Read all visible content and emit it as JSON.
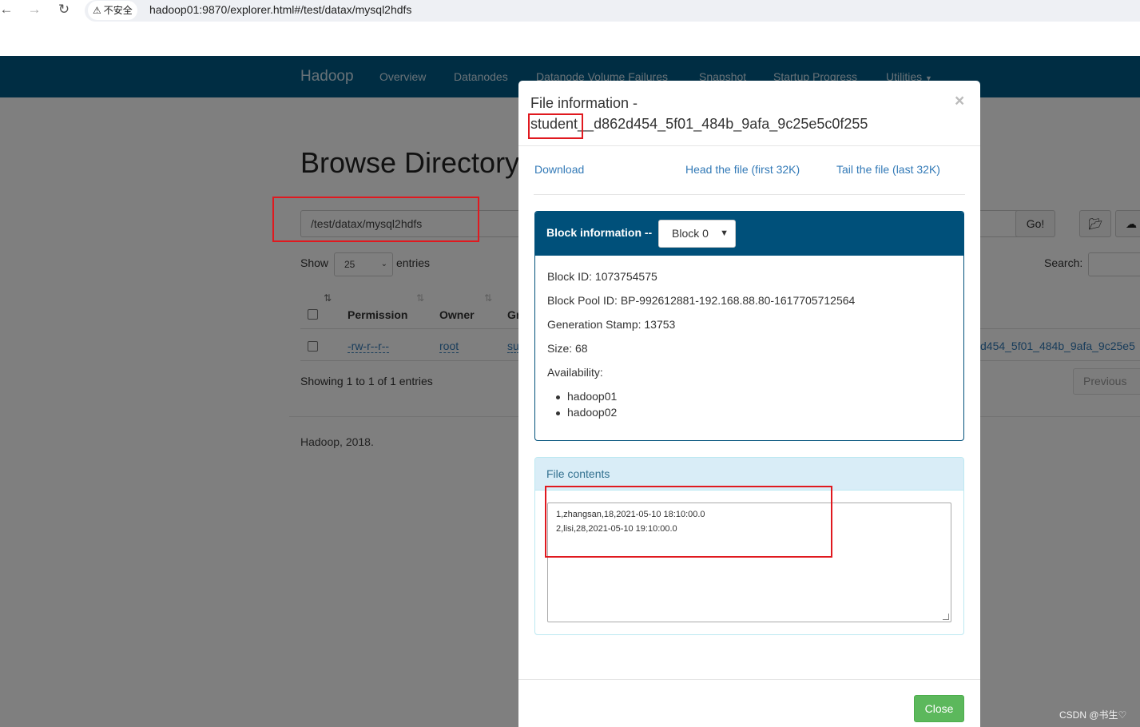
{
  "browser": {
    "security_label": "不安全",
    "url": "hadoop01:9870/explorer.html#/test/datax/mysql2hdfs"
  },
  "navbar": {
    "brand": "Hadoop",
    "links": [
      "Overview",
      "Datanodes",
      "Datanode Volume Failures",
      "Snapshot",
      "Startup Progress",
      "Utilities"
    ]
  },
  "browse": {
    "title": "Browse Directory",
    "path_value": "/test/datax/mysql2hdfs",
    "go_label": "Go!",
    "show_label": "Show",
    "page_size": "25",
    "entries_label": "entries",
    "search_label": "Search:",
    "columns": [
      "Permission",
      "Owner",
      "Gr"
    ],
    "row": {
      "permission": "-rw-r--r--",
      "owner": "root",
      "group": "su",
      "name_fragment": "d454_5f01_484b_9afa_9c25e5"
    },
    "showing_text": "Showing 1 to 1 of 1 entries",
    "previous_label": "Previous",
    "footer": "Hadoop, 2018."
  },
  "modal": {
    "title_line1": "File information -",
    "title_line2": "student__d862d454_5f01_484b_9afa_9c25e5c0f255",
    "download_label": "Download",
    "head_label": "Head the file (first 32K)",
    "tail_label": "Tail the file (last 32K)",
    "block_header": "Block information --",
    "block_selected": "Block 0",
    "block_id": "Block ID: 1073754575",
    "block_pool_id": "Block Pool ID: BP-992612881-192.168.88.80-1617705712564",
    "generation_stamp": "Generation Stamp: 13753",
    "size": "Size: 68",
    "availability_label": "Availability:",
    "availability": [
      "hadoop01",
      "hadoop02"
    ],
    "file_contents_label": "File contents",
    "file_lines": [
      "1,zhangsan,18,2021-05-10 18:10:00.0",
      "2,lisi,28,2021-05-10 19:10:00.0"
    ],
    "close_label": "Close"
  },
  "watermark": "CSDN @书生♡",
  "colors": {
    "navbar": "#005b86",
    "panel_primary": "#00507a",
    "link": "#337ab7",
    "success": "#5cb85c",
    "annotation": "#e0191f"
  }
}
